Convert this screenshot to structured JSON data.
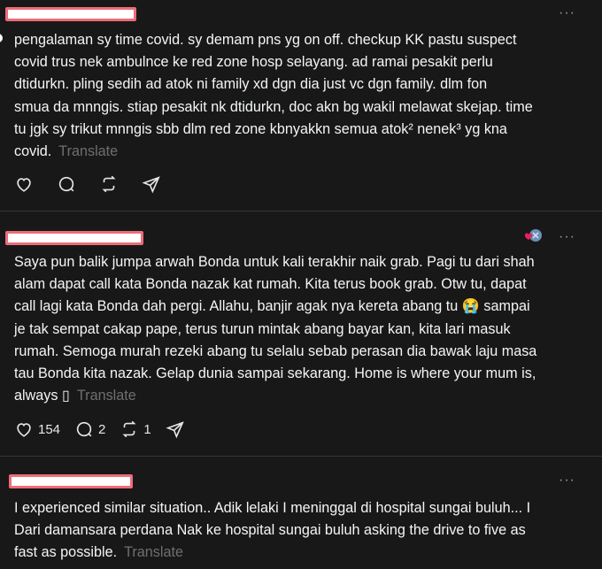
{
  "posts": [
    {
      "text": "pengalaman sy time covid. sy demam pns yg on off. checkup KK pastu suspect\ncovid trus nek ambulnce ke red zone hosp selayang. ad ramai pesakit perlu\ndtidurkn. pling sedih ad atok ni family xd dgn dia just vc dgn family. dlm fon\nsmua da mnngis. stiap pesakit nk dtidurkn, doc akn bg wakil melawat skejap. time\ntu jgk sy trikut mnngis sbb dlm red zone kbnyakkn semua atok² nenek³ yg kna\ncovid.",
      "translate": "Translate",
      "more": "···"
    },
    {
      "text": "Saya pun balik jumpa arwah Bonda untuk kali terakhir naik grab. Pagi tu dari shah\nalam dapat call kata Bonda nazak kat rumah. Kita terus book grab. Otw tu, dapat\ncall lagi kata Bonda dah pergi. Allahu, banjir agak nya kereta abang tu 😭 sampai\nje tak sempat cakap pape, terus turun mintak abang bayar kan, kita lari masuk\nrumah. Semoga murah rezeki abang tu selalu sebab perasan dia bawak laju masa\ntau Bonda kita nazak. Gelap dunia sampai sekarang. Home is where your mum is,\nalways ▯",
      "translate": "Translate",
      "more": "···",
      "likes": "154",
      "replies": "2",
      "reposts": "1"
    },
    {
      "text": "I experienced similar situation.. Adik lelaki I meninggal di hospital sungai buluh... I\nDari damansara perdana Nak ke hospital sungai buluh asking the drive to five as\nfast as possible.",
      "translate": "Translate",
      "more": "···"
    }
  ],
  "colors": {
    "bg": "#181818",
    "text": "#f3f5f7",
    "muted": "#6f6f6f",
    "redaction_border": "#ec6d78"
  }
}
